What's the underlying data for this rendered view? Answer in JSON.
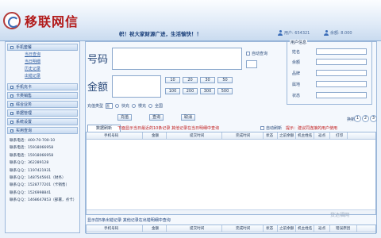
{
  "header": {
    "logo_text": "移联网信",
    "slogan": "帜！祝大家财源广进，生活愉快！！",
    "user_label": "用户: 654321",
    "balance_label": "余额: 8.000"
  },
  "sidebar": {
    "groups": [
      {
        "label": "手机套餐",
        "items": [
          "当日查询",
          "当日明细",
          "历史记录",
          "出错记录"
        ]
      },
      {
        "label": "手机充卡"
      },
      {
        "label": "卡类销售"
      },
      {
        "label": "综合业务"
      },
      {
        "label": "单据管理"
      },
      {
        "label": "系统设置"
      },
      {
        "label": "实用查询"
      }
    ],
    "contacts": [
      "联系电话：400-70-700-10",
      "联系电话：15918066958",
      "联系电话：15918066958",
      "联系ＱＱ：362289128",
      "联系ＱＱ：1197421931",
      "联系ＱＱ：1487545661（财务）",
      "联系ＱＱ：1528777201（卡销售）",
      "联系ＱＱ：1526998841",
      "联系ＱＱ：1468647853（部署，点卡）"
    ]
  },
  "form": {
    "phone_label": "号码",
    "amount_label": "金额",
    "auto_query_label": "自动查询",
    "amounts_row1": [
      "10",
      "20",
      "30",
      "50"
    ],
    "amounts_row2": [
      "100",
      "200",
      "300",
      "500"
    ],
    "recharge_type_label": "充值类型",
    "type_select_value": "直",
    "radio_options": [
      "快充",
      "慢充",
      "全国"
    ],
    "buttons": [
      "充值",
      "查询",
      "取消"
    ]
  },
  "sender": {
    "legend": "用户信息",
    "fields": [
      "姓名",
      "余额",
      "品牌",
      "属地",
      "状态"
    ]
  },
  "table": {
    "switch_label": "换新",
    "pages": [
      "1",
      "2",
      "3"
    ],
    "tab_label": "数据刷新",
    "notice_1": "下面显示当日最近的10条记录 其他记录在当日明细中查询",
    "auto_refresh_label": "自动刷新",
    "notice_2": "提示：建议同连接的用户使用",
    "columns": [
      "手机号码",
      "金额",
      "提交时间",
      "完成时间",
      "状态",
      "之前余额",
      "机主姓名",
      "返点",
      "打印"
    ],
    "bottom_columns": [
      "手机号码",
      "金额",
      "提交时间",
      "完成时间",
      "状态",
      "之前余额",
      "机主姓名",
      "返点",
      "错误原因"
    ],
    "bottom_note": "显示前5条出错记录 其他记录在出错明细中查询"
  },
  "watermark": "货达福网"
}
